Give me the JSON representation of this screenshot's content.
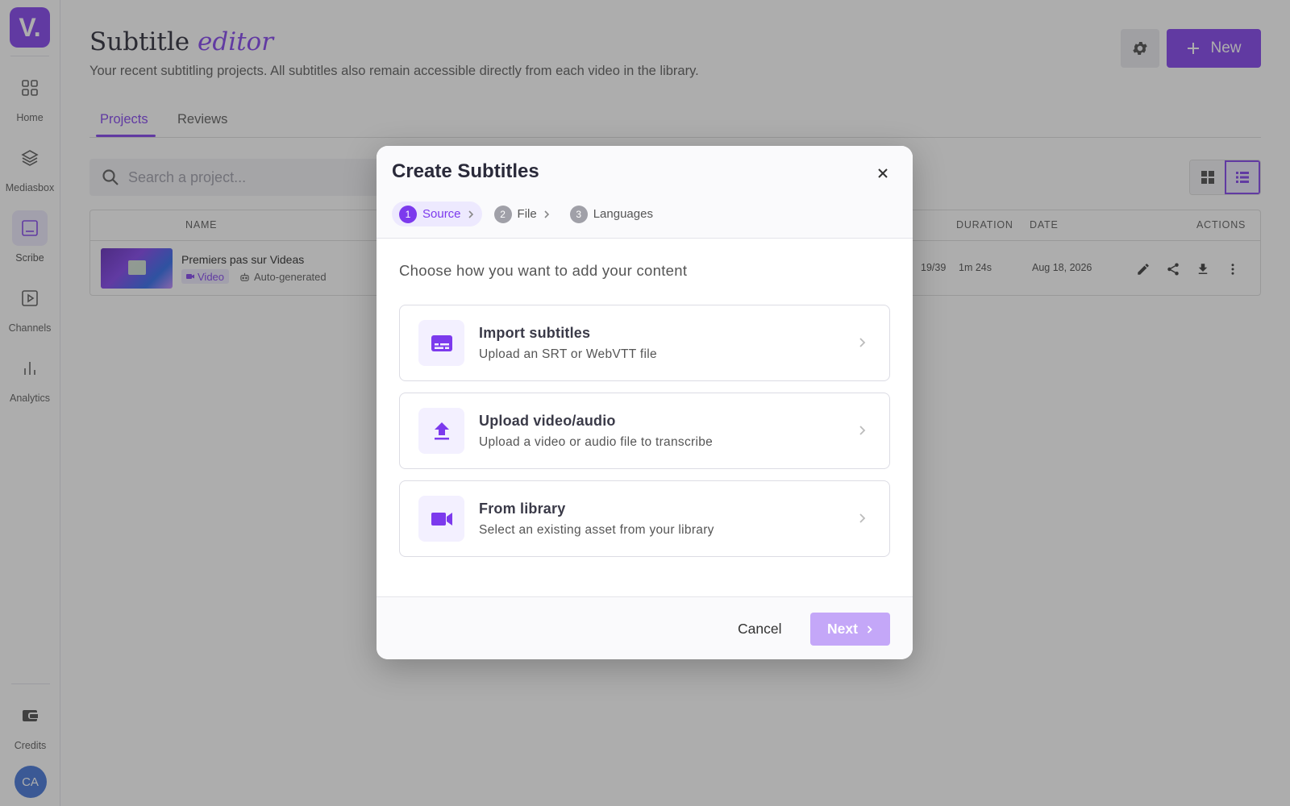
{
  "sidebar": {
    "logo": "V.",
    "items": [
      {
        "label": "Home",
        "icon": "grid-icon"
      },
      {
        "label": "Mediasbox",
        "icon": "layers-icon"
      },
      {
        "label": "Scribe",
        "icon": "subtitle-icon",
        "active": true
      },
      {
        "label": "Channels",
        "icon": "play-icon"
      },
      {
        "label": "Analytics",
        "icon": "bar-chart-icon"
      }
    ],
    "credits_label": "Credits",
    "avatar_initials": "CA"
  },
  "header": {
    "title_plain": "Subtitle",
    "title_accent": "editor",
    "subtitle": "Your recent subtitling projects. All subtitles also remain accessible directly from each video in the library.",
    "new_button": "New"
  },
  "tabs": [
    {
      "label": "Projects",
      "active": true
    },
    {
      "label": "Reviews"
    }
  ],
  "search": {
    "placeholder": "Search a project..."
  },
  "table": {
    "columns": {
      "name": "NAME",
      "duration": "DURATION",
      "date": "DATE",
      "actions": "ACTIONS"
    },
    "rows": [
      {
        "name": "Premiers pas sur Videas",
        "type_badge": "Video",
        "source_badge": "Auto-generated",
        "count": "19/39",
        "duration": "1m 24s",
        "date": "Aug 18, 2026"
      }
    ]
  },
  "modal": {
    "title": "Create Subtitles",
    "steps": [
      {
        "num": "1",
        "label": "Source"
      },
      {
        "num": "2",
        "label": "File"
      },
      {
        "num": "3",
        "label": "Languages"
      }
    ],
    "prompt": "Choose how you want to add your content",
    "options": [
      {
        "title": "Import subtitles",
        "desc": "Upload an SRT or WebVTT file",
        "icon": "subtitles-icon"
      },
      {
        "title": "Upload video/audio",
        "desc": "Upload a video or audio file to transcribe",
        "icon": "upload-icon"
      },
      {
        "title": "From library",
        "desc": "Select an existing asset from your library",
        "icon": "video-camera-icon"
      }
    ],
    "cancel": "Cancel",
    "next": "Next"
  },
  "colors": {
    "accent": "#7c3aed",
    "accent_light": "#ede9fe",
    "next_disabled": "#c4a7f8"
  }
}
